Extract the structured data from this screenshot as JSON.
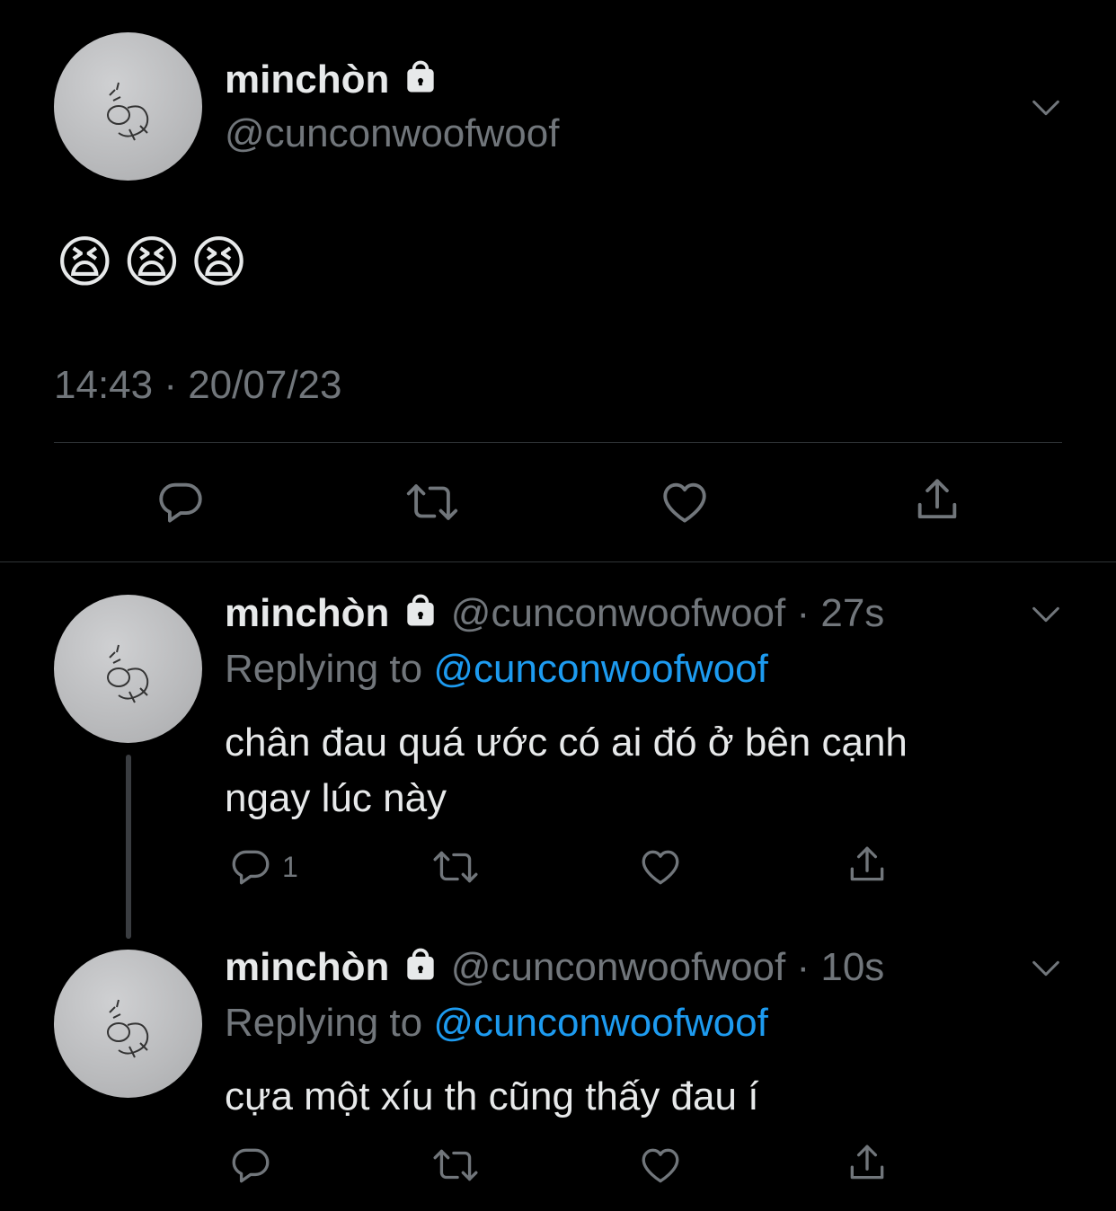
{
  "main_tweet": {
    "display_name": "minchòn",
    "handle": "@cunconwoofwoof",
    "text": "😫😫😫",
    "timestamp": "14:43 · 20/07/23"
  },
  "replies": [
    {
      "display_name": "minchòn",
      "handle": "@cunconwoofwoof",
      "age": "· 27s",
      "replying_prefix": "Replying to",
      "replying_handle": "@cunconwoofwoof",
      "text_line1": "chân đau quá ước có ai đó ở bên cạnh",
      "text_line2": "ngay lúc này",
      "reply_count": "1"
    },
    {
      "display_name": "minchòn",
      "handle": "@cunconwoofwoof",
      "age": "· 10s",
      "replying_prefix": "Replying to",
      "replying_handle": "@cunconwoofwoof",
      "text_line1": "cựa một xíu th cũng thấy đau í",
      "reply_count": ""
    }
  ],
  "icons": {
    "reply": "reply-icon",
    "retweet": "retweet-icon",
    "like": "heart-icon",
    "share": "share-icon",
    "more": "chevron-down-icon",
    "protected": "lock-icon"
  },
  "colors": {
    "background": "#000000",
    "text": "#e7e9ea",
    "muted": "#71767b",
    "link": "#1d9bf0",
    "divider": "#2f3336"
  }
}
